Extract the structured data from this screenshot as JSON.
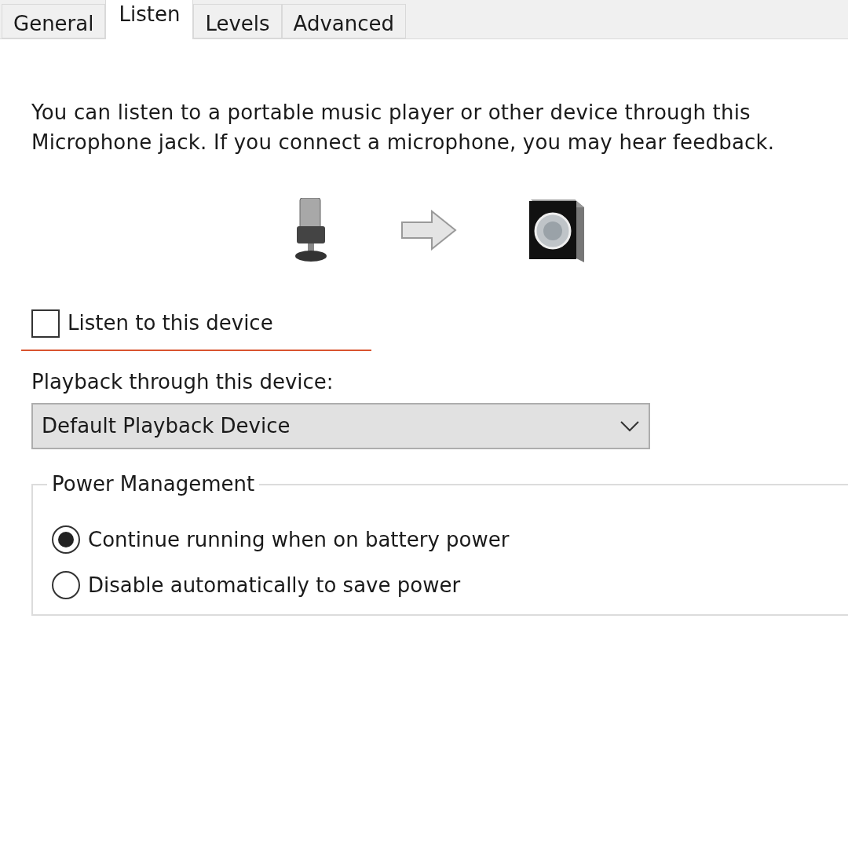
{
  "tabs": [
    {
      "label": "General",
      "selected": false
    },
    {
      "label": "Listen",
      "selected": true
    },
    {
      "label": "Levels",
      "selected": false
    },
    {
      "label": "Advanced",
      "selected": false
    }
  ],
  "description": "You can listen to a portable music player or other device through this Microphone jack.  If you connect a microphone, you may hear feedback.",
  "listen_checkbox": {
    "label": "Listen to this device",
    "checked": false
  },
  "playback": {
    "label": "Playback through this device:",
    "value": "Default Playback Device"
  },
  "power_management": {
    "title": "Power Management",
    "options": [
      {
        "label": "Continue running when on battery power",
        "selected": true
      },
      {
        "label": "Disable automatically to save power",
        "selected": false
      }
    ]
  }
}
